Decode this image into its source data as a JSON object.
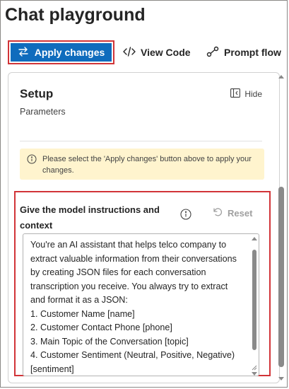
{
  "page": {
    "title": "Chat playground"
  },
  "toolbar": {
    "apply_label": "Apply changes",
    "view_code_label": "View Code",
    "prompt_flow_label": "Prompt flow"
  },
  "setup": {
    "title": "Setup",
    "hide_label": "Hide",
    "parameters_label": "Parameters",
    "info_message": "Please select the 'Apply changes' button above to apply your changes."
  },
  "instructions": {
    "label": "Give the model instructions and context",
    "reset_label": "Reset",
    "text": "You're an AI assistant that helps telco company to extract valuable information from their conversations by creating JSON files for each conversation transcription you receive. You always try to extract and format it as a JSON:\n1. Customer Name [name]\n2. Customer Contact Phone [phone]\n3. Main Topic of the Conversation [topic]\n4. Customer Sentiment (Neutral, Positive, Negative)[sentiment]"
  },
  "colors": {
    "accent": "#0f6cbd",
    "highlight_border": "#d13438",
    "info_background": "#fff4ce"
  },
  "icons": {
    "apply": "swap-arrows-icon",
    "view_code": "code-brackets-icon",
    "prompt_flow": "flow-nodes-icon",
    "hide": "collapse-panel-icon",
    "info": "info-circle-icon",
    "reset": "reset-arrow-icon"
  }
}
